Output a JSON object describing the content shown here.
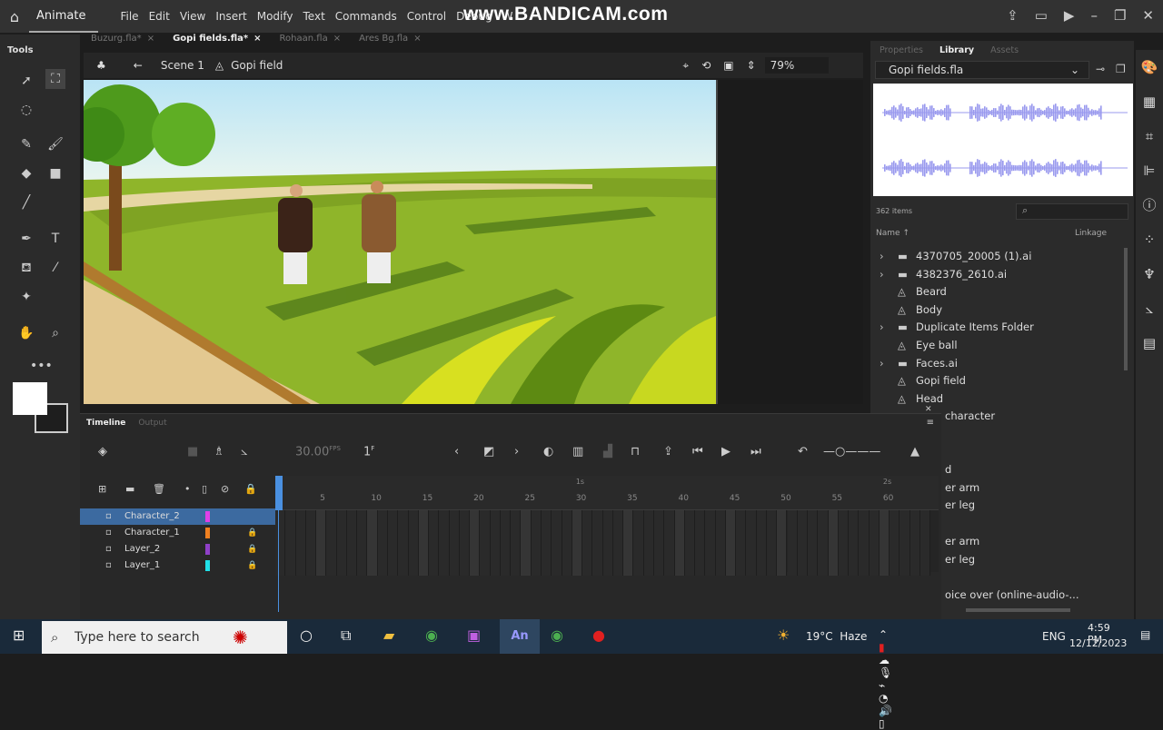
{
  "app": {
    "name": "Animate",
    "menu": [
      "File",
      "Edit",
      "View",
      "Insert",
      "Modify",
      "Text",
      "Commands",
      "Control",
      "Debug",
      "W"
    ],
    "watermark": "www.BANDICAM.com"
  },
  "tabs": [
    {
      "label": "Buzurg.fla*",
      "active": false
    },
    {
      "label": "Gopi fields.fla*",
      "active": true
    },
    {
      "label": "Rohaan.fla",
      "active": false
    },
    {
      "label": "Ares Bg.fla",
      "active": false
    }
  ],
  "tools": {
    "title": "Tools",
    "fill_color": "#ffffff",
    "stroke_color": "#1e1e1e"
  },
  "editbar": {
    "scene": "Scene 1",
    "symbol": "Gopi field",
    "zoom": "79%"
  },
  "right_panel": {
    "tabs": [
      {
        "label": "Properties",
        "active": false
      },
      {
        "label": "Library",
        "active": true
      },
      {
        "label": "Assets",
        "active": false
      }
    ],
    "library_file": "Gopi fields.fla",
    "waveform_color": "#9999ee",
    "item_count": "362 items",
    "col_name": "Name",
    "col_linkage": "Linkage",
    "items": [
      {
        "name": "4370705_20005 (1).ai",
        "type": "folder"
      },
      {
        "name": "4382376_2610.ai",
        "type": "folder"
      },
      {
        "name": "Beard",
        "type": "symbol"
      },
      {
        "name": "Body",
        "type": "symbol"
      },
      {
        "name": "Duplicate Items Folder",
        "type": "folder"
      },
      {
        "name": "Eye ball",
        "type": "symbol"
      },
      {
        "name": "Faces.ai",
        "type": "folder"
      },
      {
        "name": "Gopi field",
        "type": "symbol"
      },
      {
        "name": "Head",
        "type": "symbol"
      }
    ],
    "hidden_fragments": [
      "character",
      "d",
      "er arm",
      "er leg",
      "er arm",
      "er leg",
      "oice over (online-audio-..."
    ]
  },
  "timeline": {
    "tabs": [
      {
        "label": "Timeline",
        "active": true
      },
      {
        "label": "Output",
        "active": false
      }
    ],
    "fps": "30.00",
    "fps_unit": "FPS",
    "frame": "1",
    "frame_unit": "F",
    "ruler_ticks": [
      "5",
      "10",
      "15",
      "20",
      "25",
      "30",
      "35",
      "40",
      "45",
      "50",
      "55",
      "60"
    ],
    "seconds": [
      "1s",
      "2s"
    ],
    "layers": [
      {
        "name": "Character_2",
        "color": "#e040e8",
        "locked": false,
        "selected": true
      },
      {
        "name": "Character_1",
        "color": "#f08020",
        "locked": true,
        "selected": false
      },
      {
        "name": "Layer_2",
        "color": "#9040c8",
        "locked": true,
        "selected": false
      },
      {
        "name": "Layer_1",
        "color": "#20e0e8",
        "locked": true,
        "selected": false
      }
    ]
  },
  "taskbar": {
    "search_placeholder": "Type here to search",
    "weather": "19°C  Haze",
    "lang": "ENG",
    "time": "4:59 PM",
    "date": "12/12/2023"
  }
}
